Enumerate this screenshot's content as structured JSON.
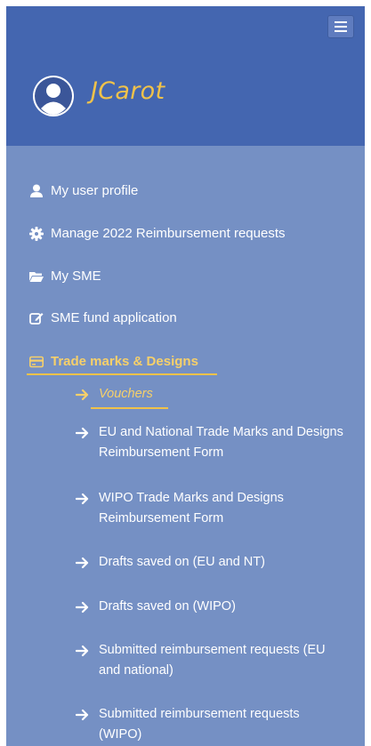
{
  "user": {
    "name": "JCarot"
  },
  "menu": [
    {
      "label": "My user profile",
      "icon": "user-icon"
    },
    {
      "label": "Manage 2022 Reimbursement requests",
      "icon": "gear-icon"
    },
    {
      "label": "My SME",
      "icon": "folder-open-icon"
    },
    {
      "label": "SME fund application",
      "icon": "edit-icon"
    },
    {
      "label": "Trade marks & Designs",
      "icon": "credit-card-icon",
      "active": true
    }
  ],
  "submenu": [
    {
      "label": "Vouchers",
      "active": true
    },
    {
      "label": "EU and National Trade Marks and Designs Reimbursement Form"
    },
    {
      "label": "WIPO Trade Marks and Designs Reimbursement Form"
    },
    {
      "label": "Drafts saved on (EU and NT)"
    },
    {
      "label": "Drafts saved on (WIPO)"
    },
    {
      "label": "Submitted reimbursement requests (EU and national)"
    },
    {
      "label": "Submitted reimbursement requests (WIPO)"
    }
  ],
  "colors": {
    "header_bg": "#4466b0",
    "panel_bg": "#7590c4",
    "accent": "#f0c24a"
  }
}
